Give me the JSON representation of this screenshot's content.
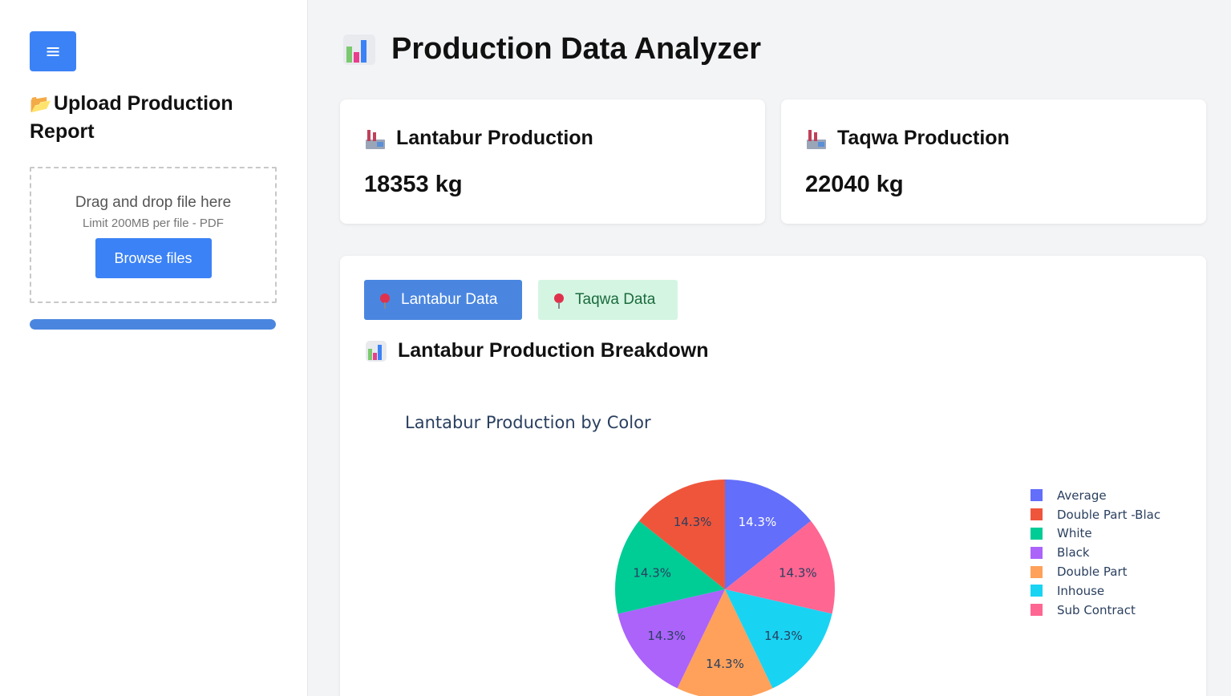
{
  "sidebar": {
    "menu_icon": "≡",
    "title_icon": "📂",
    "title": "Upload Production Report",
    "dropzone": {
      "main_text": "Drag and drop file here",
      "sub_text": "Limit 200MB per file - PDF",
      "browse_label": "Browse files"
    },
    "progress_fraction": 1.0
  },
  "header": {
    "title": "Production Data Analyzer"
  },
  "stats": [
    {
      "title": "Lantabur Production",
      "value": "18353 kg"
    },
    {
      "title": "Taqwa Production",
      "value": "22040 kg"
    }
  ],
  "tabs": [
    {
      "label": "Lantabur Data",
      "active": true
    },
    {
      "label": "Taqwa Data",
      "active": false
    }
  ],
  "breakdown_title": "Lantabur Production Breakdown",
  "chart_data": {
    "type": "pie",
    "title": "Lantabur Production by Color",
    "labels": [
      "Average",
      "Double Part -Blac",
      "White",
      "Black",
      "Double Part",
      "Inhouse",
      "Sub Contract"
    ],
    "values": [
      14.3,
      14.3,
      14.3,
      14.3,
      14.3,
      14.3,
      14.3
    ],
    "slice_labels": [
      "14.3%",
      "14.3%",
      "14.3%",
      "14.3%",
      "14.3%",
      "14.3%",
      "14.3%"
    ],
    "colors": [
      "#636efa",
      "#ef553b",
      "#00cc96",
      "#ab63fa",
      "#ffa15a",
      "#19d3f3",
      "#ff6692"
    ],
    "legend_position": "right"
  },
  "colors": {
    "accent": "#3b82f6",
    "tab_active": "#4a86e0",
    "tab_inactive_bg": "#d5f5e3"
  }
}
